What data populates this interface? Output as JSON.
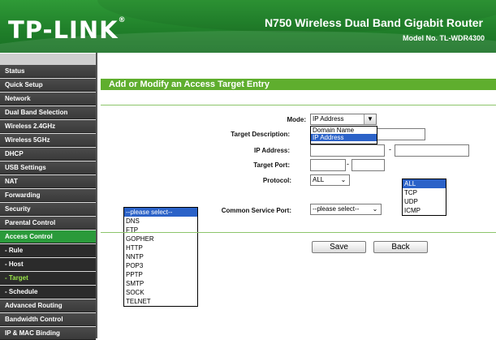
{
  "header": {
    "logo": "TP-LINK",
    "logo_reg": "®",
    "router_name": "N750 Wireless Dual Band Gigabit Router",
    "model_no": "Model No. TL-WDR4300"
  },
  "colors": {
    "brand_green": "#2f9a37",
    "title_green": "#5fae2e",
    "menu_dark": "#3a3a3a",
    "menu_active": "#2a9a3a",
    "selection_blue": "#2b62c8"
  },
  "sidebar": {
    "items": [
      {
        "label": "Status"
      },
      {
        "label": "Quick Setup"
      },
      {
        "label": "Network"
      },
      {
        "label": "Dual Band Selection"
      },
      {
        "label": "Wireless 2.4GHz"
      },
      {
        "label": "Wireless 5GHz"
      },
      {
        "label": "DHCP"
      },
      {
        "label": "USB Settings"
      },
      {
        "label": "NAT"
      },
      {
        "label": "Forwarding"
      },
      {
        "label": "Security"
      },
      {
        "label": "Parental Control"
      },
      {
        "label": "Access Control"
      },
      {
        "label": "- Rule"
      },
      {
        "label": "- Host"
      },
      {
        "label": "- Target"
      },
      {
        "label": "- Schedule"
      },
      {
        "label": "Advanced Routing"
      },
      {
        "label": "Bandwidth Control"
      },
      {
        "label": "IP & MAC Binding"
      }
    ]
  },
  "page": {
    "title": "Add or Modify an Access Target Entry",
    "mode_label": "Mode:",
    "mode_value": "IP Address",
    "mode_options": [
      "Domain Name",
      "IP Address"
    ],
    "target_description_label": "Target Description:",
    "ip_address_label": "IP Address:",
    "ip_separator": "-",
    "target_port_label": "Target Port:",
    "port_separator": "-",
    "protocol_label": "Protocol:",
    "protocol_value": "ALL",
    "protocol_options": [
      "ALL",
      "TCP",
      "UDP",
      "ICMP"
    ],
    "common_service_port_label": "Common Service Port:",
    "common_service_port_value": "--please select--",
    "service_options": [
      "--please select--",
      "DNS",
      "FTP",
      "GOPHER",
      "HTTP",
      "NNTP",
      "POP3",
      "PPTP",
      "SMTP",
      "SOCK",
      "TELNET"
    ],
    "save_label": "Save",
    "back_label": "Back",
    "dropdown_arrow_icon": "chevron-down-icon"
  }
}
